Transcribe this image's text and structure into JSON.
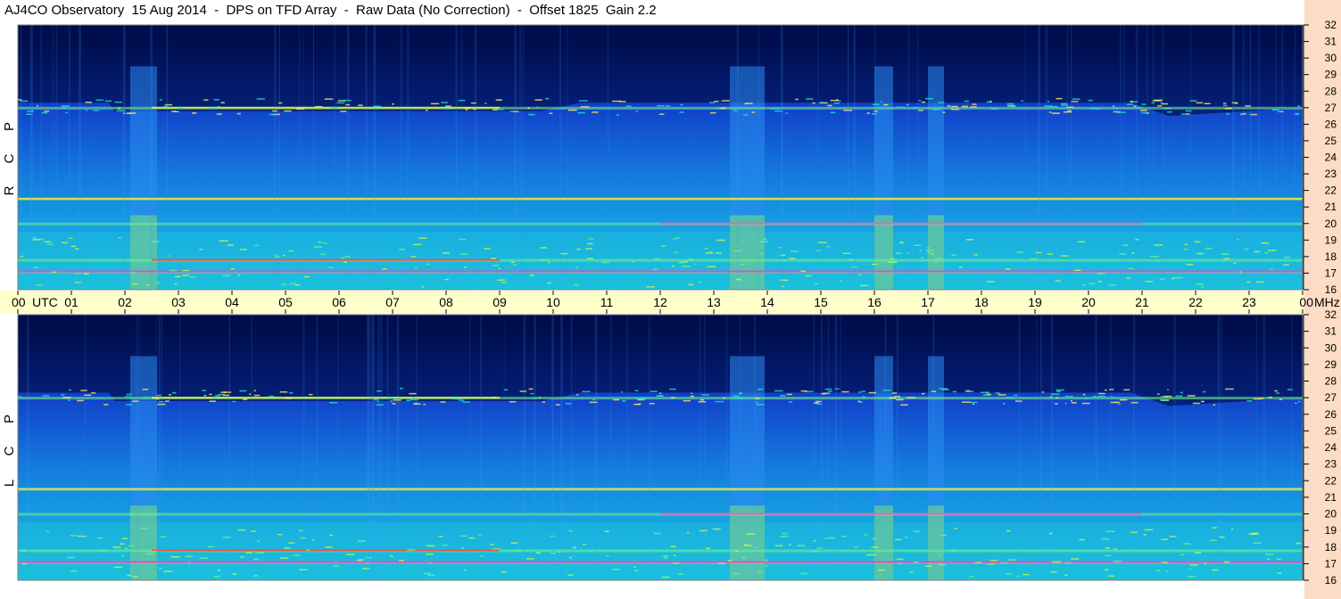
{
  "title": "AJ4CO Observatory  15 Aug 2014  -  DPS on TFD Array  -  Raw Data (No Correction)  -  Offset 1825  Gain 2.2",
  "colors": {
    "background": "#ffffff",
    "axis_band": "#ffffcc",
    "right_strip": "#fcdcc4",
    "spectrum_low": "#00004a",
    "spectrum_mid": "#1a9ae0",
    "spectrum_high": "#ff00cc"
  },
  "chart_data": {
    "type": "heatmap",
    "time_axis": {
      "labels": [
        "00",
        "01",
        "02",
        "03",
        "04",
        "05",
        "06",
        "07",
        "08",
        "09",
        "10",
        "11",
        "12",
        "13",
        "14",
        "15",
        "16",
        "17",
        "18",
        "19",
        "20",
        "21",
        "22",
        "23",
        "00"
      ],
      "unit_left": "UTC",
      "unit_right": "MHz",
      "range_hours": [
        0,
        24
      ]
    },
    "freq_axis": {
      "range_mhz": [
        16,
        32
      ],
      "labels": [
        "16",
        "17",
        "18",
        "19",
        "20",
        "21",
        "22",
        "23",
        "24",
        "25",
        "26",
        "27",
        "28",
        "29",
        "30",
        "31",
        "32"
      ]
    },
    "panels": [
      {
        "label": "R C P"
      },
      {
        "label": "L C P"
      }
    ],
    "broadband_bursts_utc": [
      [
        2.1,
        2.6
      ],
      [
        13.3,
        13.95
      ],
      [
        16.0,
        16.35
      ],
      [
        17.0,
        17.3
      ]
    ],
    "interference_bands_mhz": [
      17.1,
      17.8,
      20.0,
      21.5,
      27.0
    ],
    "ionospheric_cutoff": {
      "hours": [
        0,
        1.7,
        1.8,
        9.8,
        10.5,
        20.8,
        21.5,
        24
      ],
      "mhz": [
        27.3,
        27.3,
        26.8,
        26.8,
        27.3,
        27.3,
        26.5,
        27.0
      ]
    }
  }
}
